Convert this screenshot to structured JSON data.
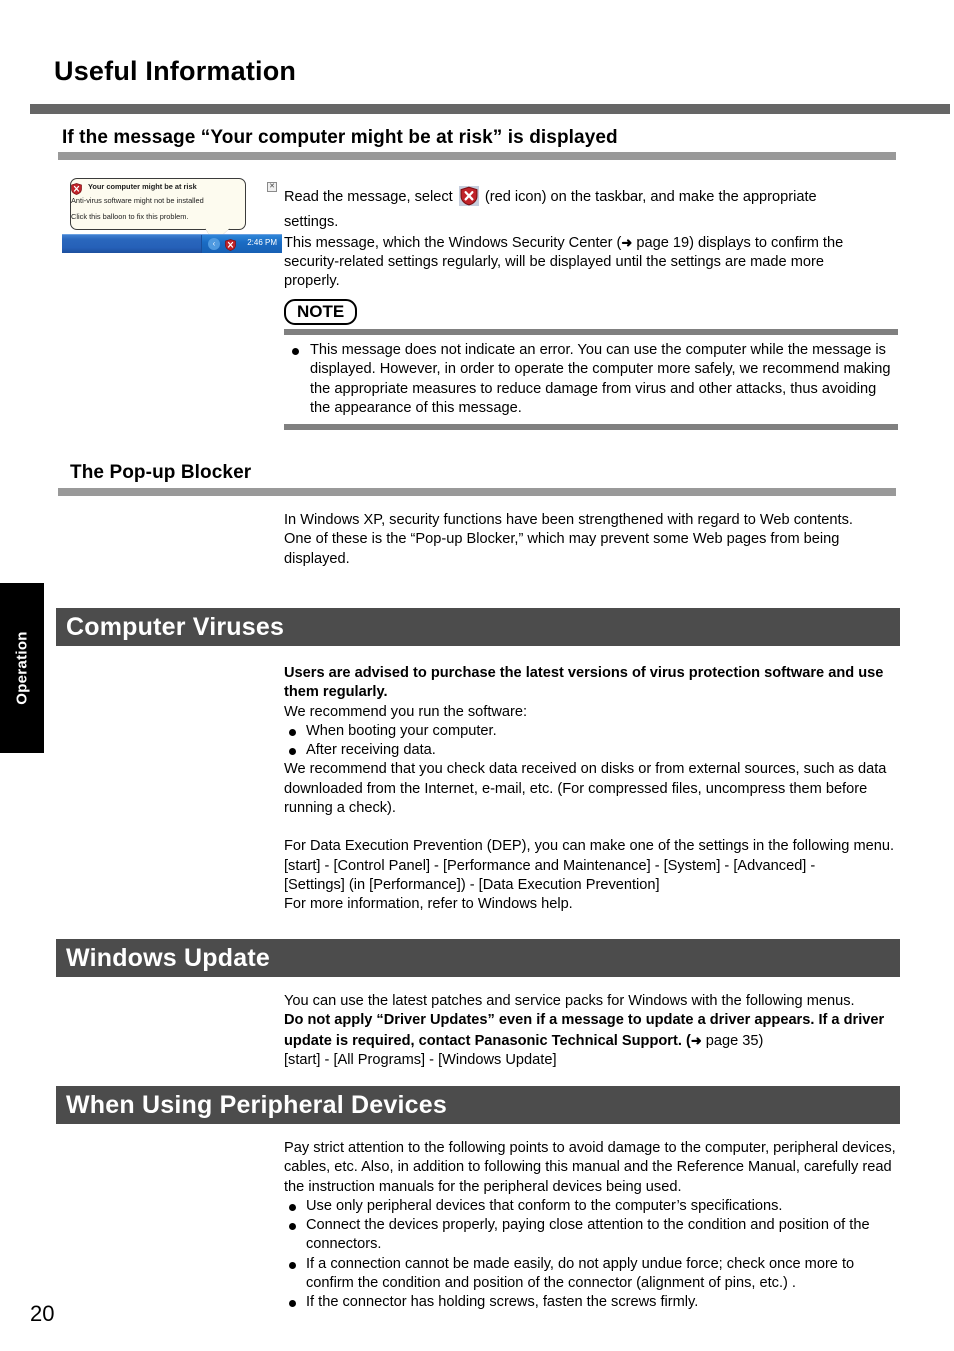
{
  "page": {
    "title": "Useful Information",
    "number": "20",
    "side_tab_label": "Operation"
  },
  "section_risk": {
    "heading": "If the message “Your computer might be at risk” is displayed",
    "screenshot": {
      "balloon_title": "Your computer might be at risk",
      "balloon_line1": "Anti-virus software might not be installed",
      "balloon_line2": "Click this balloon to fix this problem.",
      "close_glyph": "✕",
      "shield_icon": "red-shield-icon",
      "tray_chevron": "‹",
      "taskbar_time": "2:46 PM"
    },
    "paragraphs": [
      {
        "segments": [
          {
            "type": "text",
            "value": "Read the message, select "
          },
          {
            "type": "icon",
            "value": "red-shield-icon"
          },
          {
            "type": "text",
            "value": " (red icon) on the taskbar, and make the appropriate"
          }
        ]
      }
    ],
    "line_settings": "settings.",
    "para2_a": "This message, which the Windows Security Center (",
    "para2_arrow": "➜",
    "para2_b": " page 19) displays to confirm the",
    "para2_c": "security-related settings regularly, will be displayed until the settings are made more",
    "para2_d": "properly.",
    "note": {
      "badge": "NOTE",
      "items": [
        "This message does not indicate an error. You can use the computer while the message is displayed. However, in order to operate the computer more safely, we recommend making the appropriate measures to reduce damage from virus and other attacks, thus avoiding the appearance of this message."
      ]
    }
  },
  "section_popup": {
    "heading": "The Pop-up Blocker",
    "para1": "In Windows XP, security functions have been strengthened with regard to Web contents.",
    "para2": "One of these is the “Pop-up Blocker,” which may prevent some Web pages from being displayed."
  },
  "section_viruses": {
    "band_title": "Computer Viruses",
    "intro_bold": "Users are advised to purchase the latest versions of virus protection software and use them regularly.",
    "intro_normal": "We recommend you run the software:",
    "bullets": [
      "When booting your computer.",
      "After receiving data."
    ],
    "para_check": "We recommend that you check data received on disks or from external sources, such as data downloaded from the Internet, e-mail, etc.  (For compressed files, uncompress them before running a check).",
    "para_dep": "For Data Execution Prevention (DEP), you can make one of the settings in the following menu.",
    "para_path1": "[start] - [Control Panel] - [Performance and Maintenance] - [System] - [Advanced] -",
    "para_path2": "[Settings] (in [Performance]) - [Data Execution Prevention]",
    "para_more": "For more information, refer to Windows help."
  },
  "section_update": {
    "band_title": "Windows Update",
    "para1": "You can use the latest patches and service packs for Windows with the following menus.",
    "para_bold_a": "Do not apply “Driver Updates” even if a message to update a driver appears. If a driver update is required, contact Panasonic Technical Support. (",
    "para_arrow": "➜",
    "para_bold_b": " page 35)",
    "para_path": "[start] - [All Programs] - [Windows Update]"
  },
  "section_peripheral": {
    "band_title": "When Using Peripheral Devices",
    "intro": "Pay strict attention to the following points to avoid damage to the computer, peripheral devices, cables, etc.  Also, in addition to following this manual and the Reference Manual, carefully read the instruction manuals for the peripheral devices being used.",
    "bullets": [
      "Use only peripheral devices that conform to the computer’s specifications.",
      "Connect the devices properly, paying close attention to the condition and position of the connectors.",
      "If a connection cannot be made easily, do not apply undue force; check once more to confirm the condition and position of the connector (alignment of pins, etc.) .",
      "If the connector has holding screws, fasten the screws firmly."
    ]
  },
  "colors": {
    "band": "#4c4c4c",
    "rule_dark": "#666666",
    "rule_light": "#999999",
    "note_rule": "#808080",
    "shield_red": "#c0232a",
    "taskbar_blue": "#2560b8"
  }
}
